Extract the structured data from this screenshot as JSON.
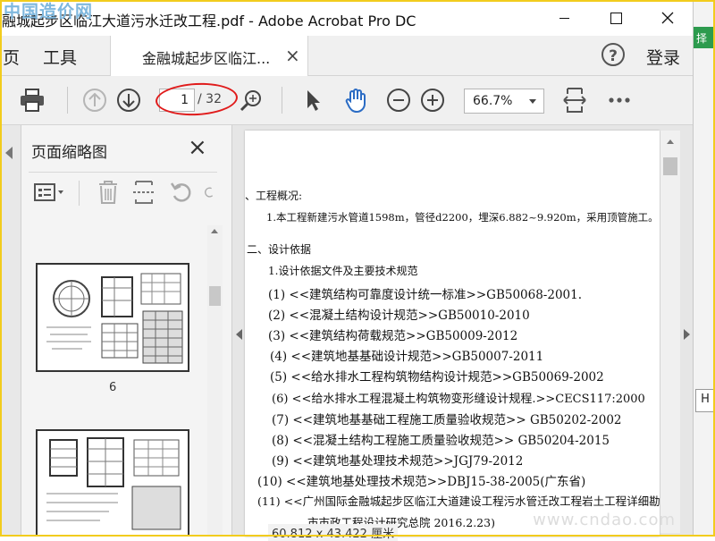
{
  "window": {
    "title": "融城起步区临江大道污水迁改工程.pdf - Adobe Acrobat Pro DC"
  },
  "watermarks": {
    "top_left": "中国造价网",
    "bottom_right": "www.cndao.com"
  },
  "right_strip": {
    "top_label": "择",
    "mid_label": "H"
  },
  "tabbar": {
    "home_label": "页",
    "tools_label": "工具",
    "doc_tab_label": "金融城起步区临江...",
    "help_label": "?",
    "login_label": "登录"
  },
  "toolbar": {
    "current_page": "1",
    "total_pages": "/ 32",
    "zoom": "66.7%"
  },
  "thumbnail_panel": {
    "title": "页面缩略图",
    "pages": [
      {
        "number": "6"
      },
      {
        "number": ""
      }
    ]
  },
  "document": {
    "lines": [
      "、工程概况:",
      "1.本工程新建污水管道1598m，管径d2200，埋深6.882~9.920m，采用顶管施工。",
      "二、设计依据",
      "1.设计依据文件及主要技术规范",
      "(1) <<建筑结构可靠度设计统一标准>>GB50068-2001.",
      "(2) <<混凝土结构设计规范>>GB50010-2010",
      "(3) <<建筑结构荷载规范>>GB50009-2012",
      "(4) <<建筑地基基础设计规范>>GB50007-2011",
      "(5) <<给水排水工程构筑物结构设计规范>>GB50069-2002",
      "(6) <<给水排水工程混凝土构筑物变形缝设计规程.>>CECS117:2000",
      "(7) <<建筑地基基础工程施工质量验收规范>> GB50202-2002",
      "(8) <<混凝土结构工程施工质量验收规范>> GB50204-2015",
      "(9) <<建筑地基处理技术规范>>JGJ79-2012",
      "(10) <<建筑地基处理技术规范>>DBJ15-38-2005(广东省)",
      "(11) <<广州国际金融城起步区临江大道建设工程污水管迁改工程岩土工程详细勘",
      "市市政工程设计研究总院   2016.2.23)"
    ],
    "page_size": "60.812 x 43.422 厘米"
  },
  "colors": {
    "frame": "#f2cc1d",
    "annotation": "#e01b1b",
    "hand_tool": "#2b6cc4",
    "chrome": "#f0f0f0"
  }
}
